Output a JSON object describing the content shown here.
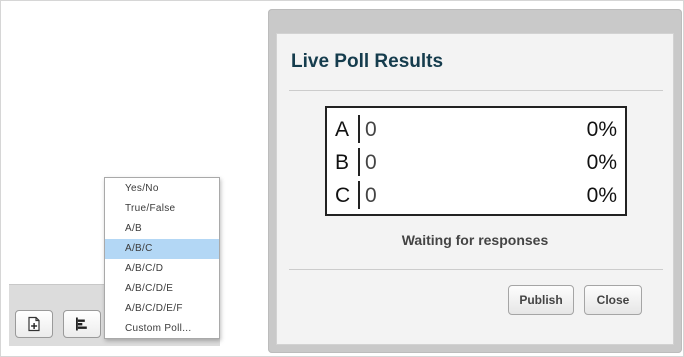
{
  "toolbar": {
    "buttons": [
      {
        "icon": "new-slide-icon"
      },
      {
        "icon": "poll-icon"
      }
    ]
  },
  "poll_menu": {
    "items": [
      {
        "label": "Yes/No",
        "selected": false
      },
      {
        "label": "True/False",
        "selected": false
      },
      {
        "label": "A/B",
        "selected": false
      },
      {
        "label": "A/B/C",
        "selected": true
      },
      {
        "label": "A/B/C/D",
        "selected": false
      },
      {
        "label": "A/B/C/D/E",
        "selected": false
      },
      {
        "label": "A/B/C/D/E/F",
        "selected": false
      },
      {
        "label": "Custom Poll...",
        "selected": false
      }
    ],
    "selected_color": "#b3d7f5"
  },
  "modal": {
    "title": "Live Poll Results",
    "title_color": "#153c4d",
    "results": [
      {
        "option": "A",
        "count": "0",
        "percent": "0%"
      },
      {
        "option": "B",
        "count": "0",
        "percent": "0%"
      },
      {
        "option": "C",
        "count": "0",
        "percent": "0%"
      }
    ],
    "status": "Waiting for responses",
    "publish_label": "Publish",
    "close_label": "Close"
  }
}
